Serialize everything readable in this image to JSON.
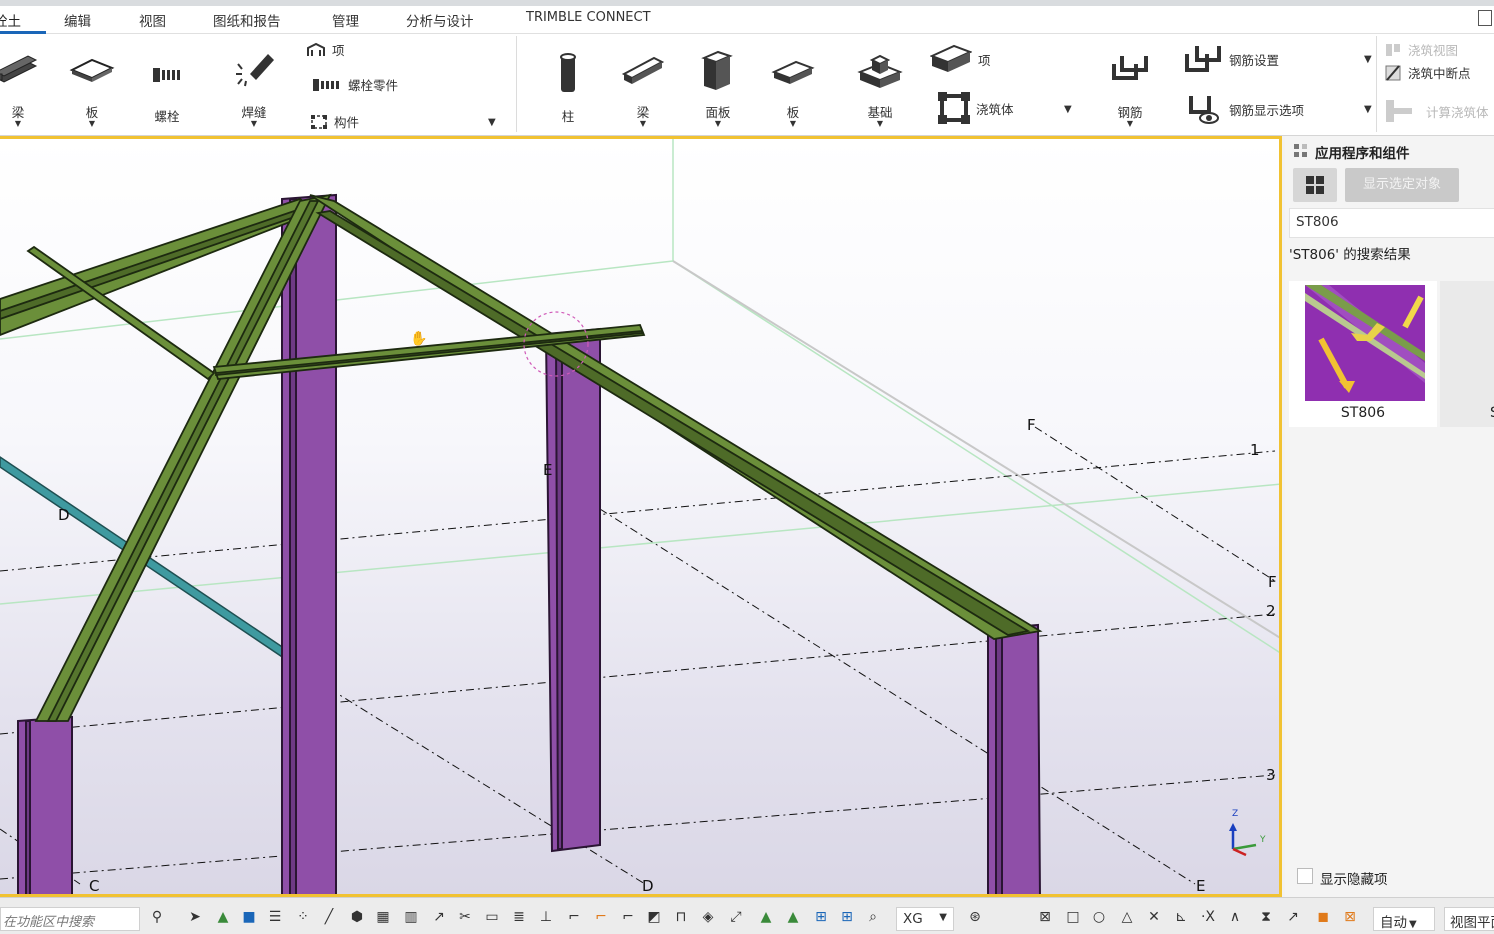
{
  "tabs": [
    {
      "label": "砼土",
      "active": true
    },
    {
      "label": "编辑"
    },
    {
      "label": "视图"
    },
    {
      "label": "图纸和报告"
    },
    {
      "label": "管理"
    },
    {
      "label": "分析与设计"
    },
    {
      "label": "TRIMBLE CONNECT"
    }
  ],
  "ribbon": {
    "steel_beam": "梁",
    "steel_plate": "板",
    "bolt": "螺栓",
    "weld": "焊缝",
    "item_small": "项",
    "bolt_parts": "螺栓零件",
    "component": "构件",
    "column": "柱",
    "concrete_beam": "梁",
    "panel": "面板",
    "slab": "板",
    "footing": "基础",
    "item": "项",
    "pour_object": "浇筑体",
    "rebar": "钢筋",
    "rebar_settings": "钢筋设置",
    "rebar_display": "钢筋显示选项",
    "pour_view": "浇筑视图",
    "pour_break": "浇筑中断点",
    "calc_pour": "计算浇筑体"
  },
  "viewport": {
    "grid_labels": {
      "F_top": "F",
      "one": "1",
      "F_right": "F",
      "two": "2",
      "three": "3",
      "D_left": "D",
      "E_mid": "E",
      "C_bottom": "C",
      "D_bottom": "D",
      "E_bottom": "E"
    },
    "axis": {
      "z": "Z",
      "y": "Y"
    }
  },
  "panel": {
    "title": "应用程序和组件",
    "show_selected": "显示选定对象",
    "search_value": "ST806",
    "search_result": "'ST806' 的搜索结果",
    "result_item": "ST806",
    "result_item_partial": "S",
    "show_hidden": "显示隐藏项"
  },
  "statusbar": {
    "search_placeholder": "在功能区中搜索",
    "filter_value": "XG",
    "snap_mode": "自动",
    "view_plane": "视图平面"
  },
  "colors": {
    "steel_green": "#6b8f3a",
    "column_purple": "#8f4fa8",
    "brace_teal": "#3f9aa0",
    "selection_yellow": "#f1c232",
    "accent_blue": "#1a66b8"
  }
}
